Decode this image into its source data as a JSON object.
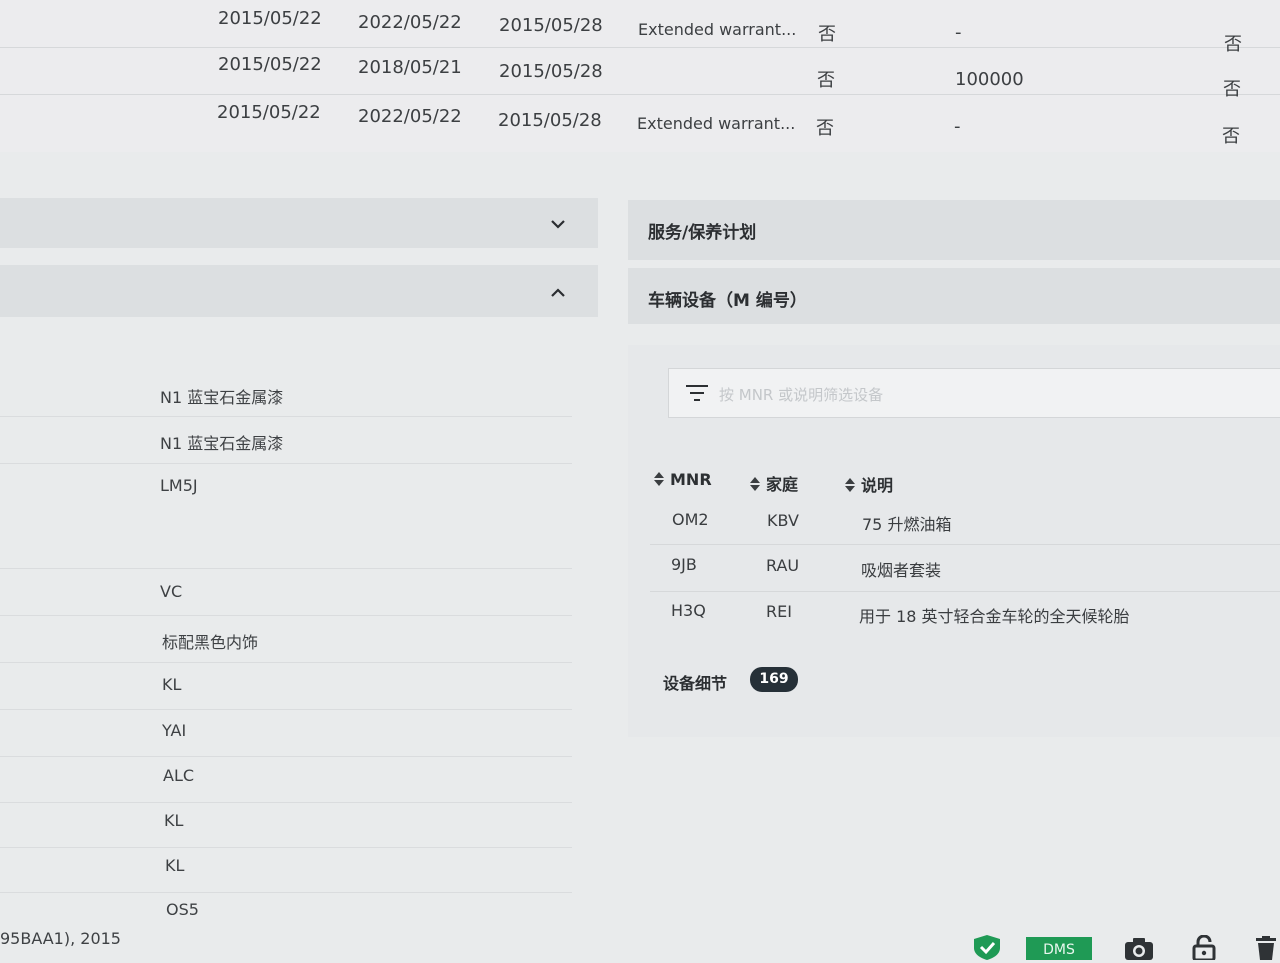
{
  "warranty_table": {
    "rows": [
      {
        "start": "2015/05/22",
        "end": "2022/05/22",
        "registered": "2015/05/28",
        "type": "Extended warrant...",
        "flag1": "否",
        "mileage": "-",
        "flag2": "否"
      },
      {
        "start": "2015/05/22",
        "end": "2018/05/21",
        "registered": "2015/05/28",
        "type": "",
        "flag1": "否",
        "mileage": "100000",
        "flag2": "否"
      },
      {
        "start": "2015/05/22",
        "end": "2022/05/22",
        "registered": "2015/05/28",
        "type": "Extended warrant...",
        "flag1": "否",
        "mileage": "-",
        "flag2": "否"
      }
    ]
  },
  "sections": {
    "service_plan": "服务/保养计划",
    "vehicle_equipment": "车辆设备（M 编号）"
  },
  "left_list": [
    "N1 蓝宝石金属漆",
    "N1 蓝宝石金属漆",
    "LM5J",
    "VC",
    "标配黑色内饰",
    "KL",
    "YAI",
    "ALC",
    "KL",
    "KL",
    "OS5"
  ],
  "footer_left_text": "95BAA1), 2015",
  "equipment": {
    "filter_placeholder": "按 MNR 或说明筛选设备",
    "columns": [
      "MNR",
      "家庭",
      "说明"
    ],
    "rows": [
      {
        "mnr": "OM2",
        "family": "KBV",
        "desc": "75 升燃油箱"
      },
      {
        "mnr": "9JB",
        "family": "RAU",
        "desc": "吸烟者套装"
      },
      {
        "mnr": "H3Q",
        "family": "REI",
        "desc": "用于 18 英寸轻合金车轮的全天候轮胎"
      }
    ],
    "details_label": "设备细节",
    "details_count": "169"
  },
  "taskbar": {
    "dms_label": "DMS",
    "icons": [
      "shield-check-icon",
      "camera-icon",
      "lock-icon",
      "trash-icon"
    ],
    "accent": "#1f9a55"
  }
}
